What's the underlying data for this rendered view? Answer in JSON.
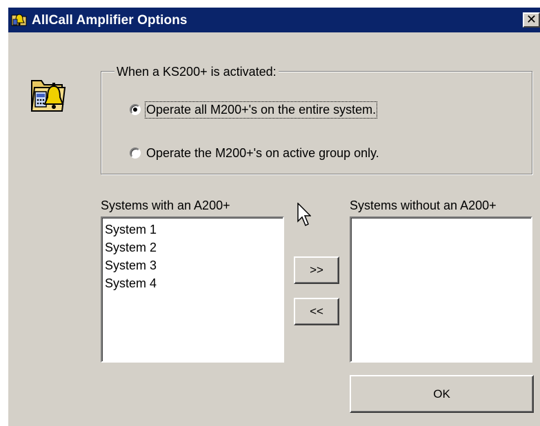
{
  "window": {
    "title": "AllCall Amplifier Options",
    "close_label": "✕"
  },
  "activation_group": {
    "legend": "When a KS200+ is activated:",
    "options": [
      {
        "label": "Operate all M200+'s on the entire system.",
        "selected": true
      },
      {
        "label": "Operate the M200+'s on active group only.",
        "selected": false
      }
    ]
  },
  "lists": {
    "with": {
      "label": "Systems with an A200+",
      "items": [
        "System 1",
        "System 2",
        "System 3",
        "System 4"
      ]
    },
    "without": {
      "label": "Systems without an A200+",
      "items": []
    }
  },
  "buttons": {
    "move_right": ">>",
    "move_left": "<<",
    "ok": "OK"
  },
  "colors": {
    "titlebar": "#0a246a",
    "face": "#d4d0c8",
    "icon_folder": "#e8c860",
    "icon_bell": "#f0d000"
  }
}
